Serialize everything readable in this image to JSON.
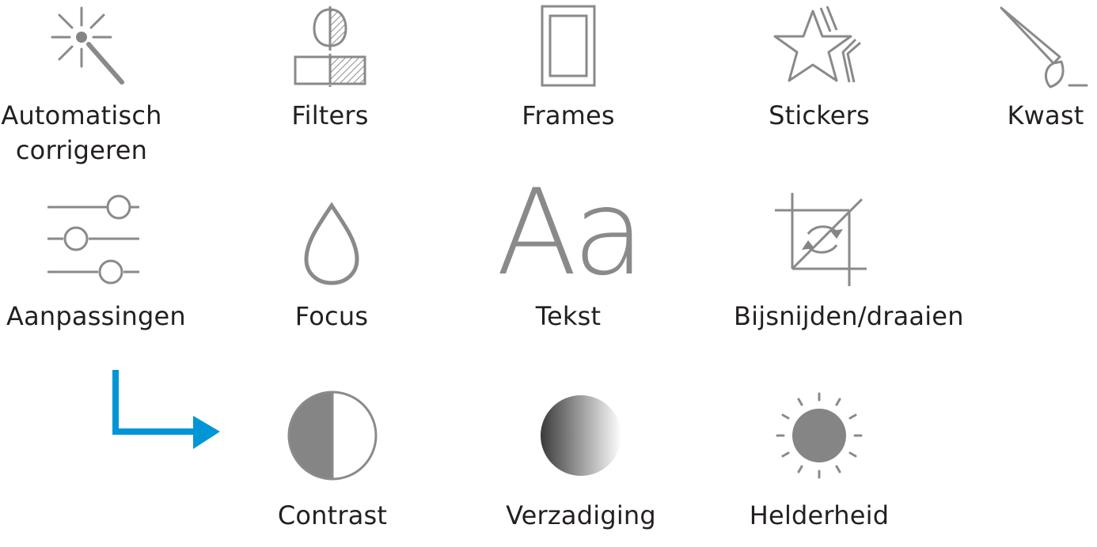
{
  "colors": {
    "icon_stroke": "#8a8a8a",
    "icon_fill": "#858585",
    "text": "#231f20",
    "arrow": "#0096d6"
  },
  "row1": {
    "auto_fix": {
      "label_line1": "Automatisch",
      "label_line2": "corrigeren",
      "icon": "magic-wand-icon"
    },
    "filters": {
      "label": "Filters",
      "icon": "filters-icon"
    },
    "frames": {
      "label": "Frames",
      "icon": "frame-icon"
    },
    "stickers": {
      "label": "Stickers",
      "icon": "star-icon"
    },
    "brush": {
      "label": "Kwast",
      "icon": "brush-icon"
    }
  },
  "row2": {
    "adjustments": {
      "label": "Aanpassingen",
      "icon": "sliders-icon"
    },
    "focus": {
      "label": "Focus",
      "icon": "drop-icon"
    },
    "text": {
      "label": "Tekst",
      "icon": "text-icon",
      "glyph": "Aa"
    },
    "crop": {
      "label": "Bijsnijden/draaien",
      "icon": "crop-rotate-icon"
    }
  },
  "row3": {
    "contrast": {
      "label": "Contrast",
      "icon": "contrast-icon"
    },
    "saturation": {
      "label": "Verzadiging",
      "icon": "saturation-icon"
    },
    "brightness": {
      "label": "Helderheid",
      "icon": "brightness-icon"
    }
  }
}
